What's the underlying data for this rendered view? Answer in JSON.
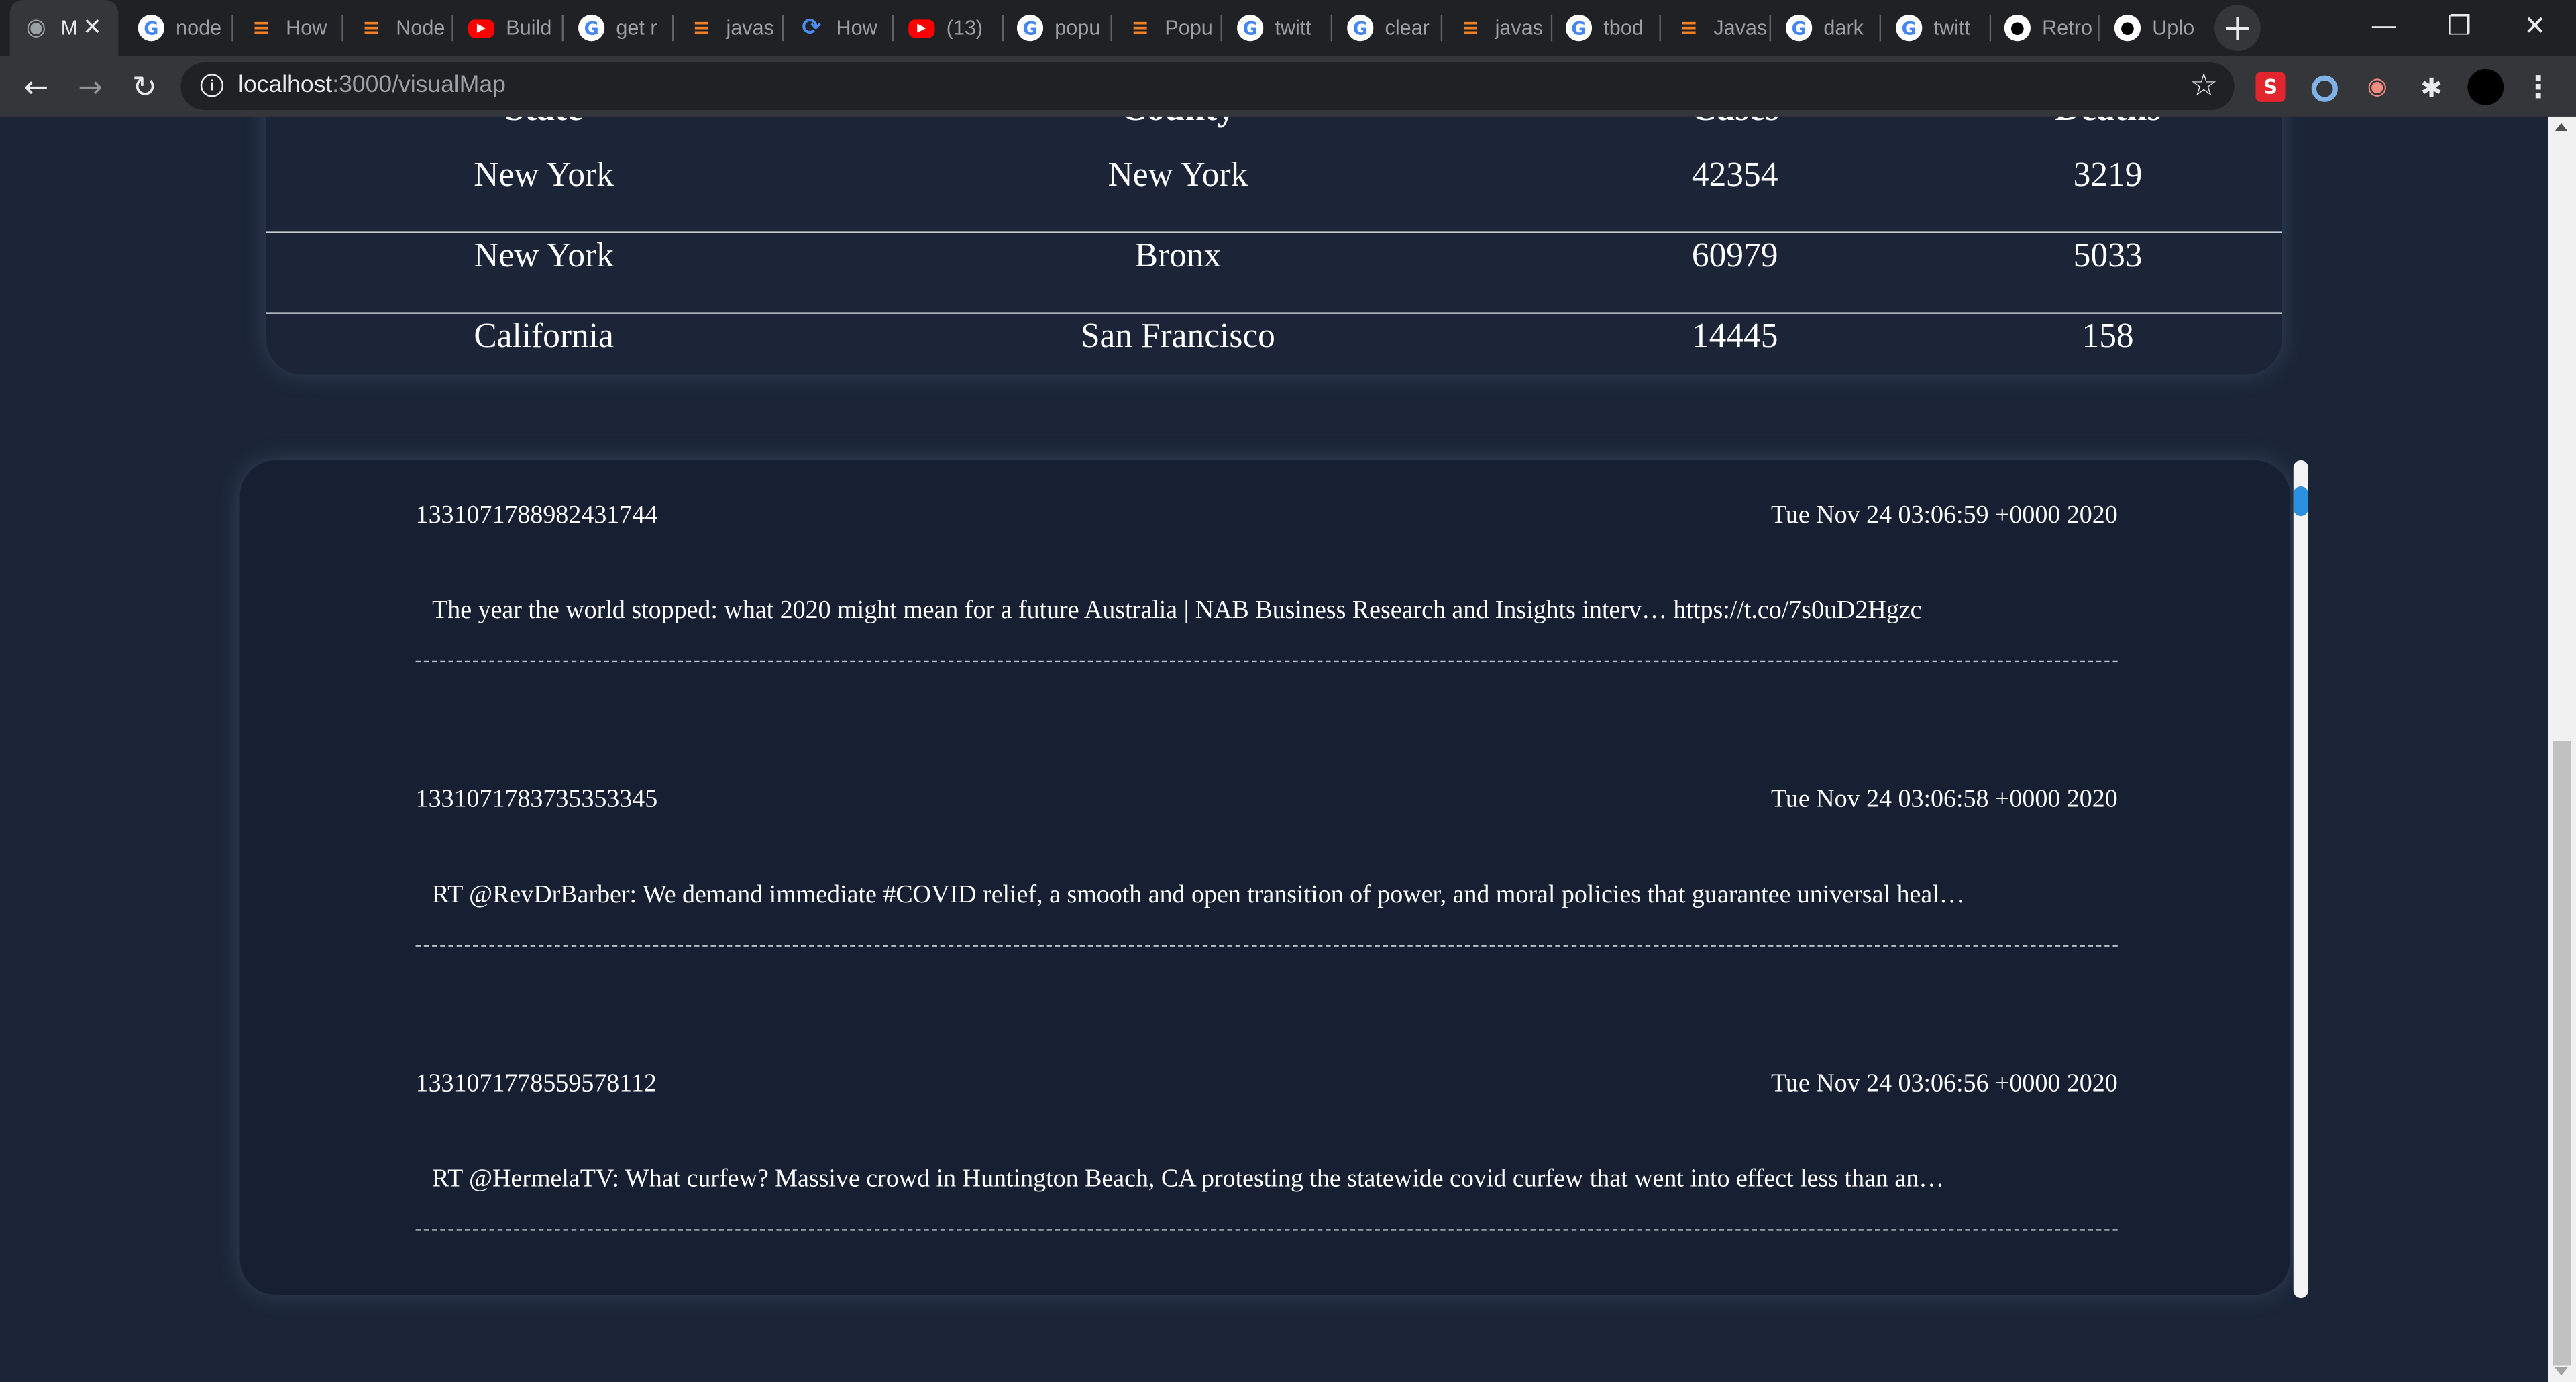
{
  "browser": {
    "tabs": [
      {
        "title": "M",
        "icon": "globe-icon",
        "active": true
      },
      {
        "title": "node",
        "icon": "google-icon"
      },
      {
        "title": "How",
        "icon": "stackoverflow-icon"
      },
      {
        "title": "Node",
        "icon": "stackoverflow-icon"
      },
      {
        "title": "Build",
        "icon": "youtube-icon"
      },
      {
        "title": "get r",
        "icon": "google-icon"
      },
      {
        "title": "javas",
        "icon": "stackoverflow-icon"
      },
      {
        "title": "How",
        "icon": "digitalocean-icon"
      },
      {
        "title": "(13)",
        "icon": "youtube-icon"
      },
      {
        "title": "popu",
        "icon": "google-icon"
      },
      {
        "title": "Popu",
        "icon": "stackoverflow-icon"
      },
      {
        "title": "twitt",
        "icon": "google-icon"
      },
      {
        "title": "clear",
        "icon": "google-icon"
      },
      {
        "title": "javas",
        "icon": "stackoverflow-icon"
      },
      {
        "title": "tbod",
        "icon": "google-icon"
      },
      {
        "title": "Javas",
        "icon": "stackoverflow-icon"
      },
      {
        "title": "dark",
        "icon": "google-icon"
      },
      {
        "title": "twitt",
        "icon": "google-icon"
      },
      {
        "title": "Retro",
        "icon": "github-icon"
      },
      {
        "title": "Uplo",
        "icon": "github-icon"
      }
    ],
    "url_host": "localhost",
    "url_path": ":3000/visualMap",
    "extensions": [
      "s-extension-icon",
      "ring-extension-icon",
      "glasses-extension-icon",
      "puzzle-icon",
      "profile-avatar"
    ]
  },
  "table": {
    "headers": [
      "State",
      "County",
      "Cases",
      "Deaths"
    ],
    "rows": [
      [
        "New York",
        "New York",
        "42354",
        "3219"
      ],
      [
        "New York",
        "Bronx",
        "60979",
        "5033"
      ],
      [
        "California",
        "San Francisco",
        "14445",
        "158"
      ]
    ]
  },
  "tweets": [
    {
      "id": "1331071788982431744",
      "date": "Tue Nov 24 03:06:59 +0000 2020",
      "text": "The year the world stopped: what 2020 might mean for a future Australia | NAB Business Research and Insights interv… https://t.co/7s0uD2Hgzc"
    },
    {
      "id": "1331071783735353345",
      "date": "Tue Nov 24 03:06:58 +0000 2020",
      "text": "RT @RevDrBarber: We demand immediate #COVID relief, a smooth and open transition of power, and moral policies that guarantee universal heal…"
    },
    {
      "id": "1331071778559578112",
      "date": "Tue Nov 24 03:06:56 +0000 2020",
      "text": "RT @HermelaTV: What curfew? Massive crowd in Huntington Beach, CA protesting the statewide covid curfew that went into effect less than an…"
    }
  ]
}
